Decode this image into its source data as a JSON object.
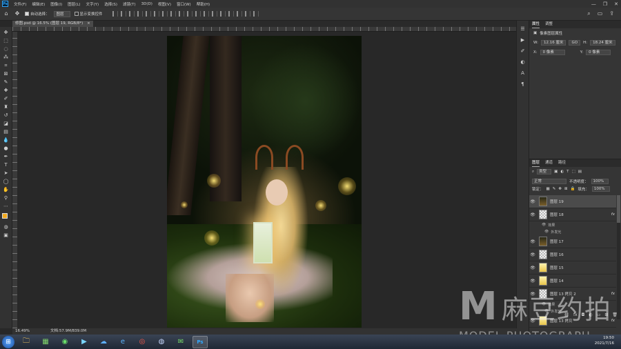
{
  "menubar": {
    "logo": "Ps",
    "items": [
      "文件(F)",
      "编辑(E)",
      "图像(I)",
      "图层(L)",
      "文字(Y)",
      "选择(S)",
      "滤镜(T)",
      "3D(D)",
      "视图(V)",
      "窗口(W)",
      "帮助(H)"
    ],
    "controls": [
      "—",
      "❐",
      "✕"
    ]
  },
  "options": {
    "auto_select_label": "自动选择：",
    "auto_select_value": "图层",
    "show_transform_label": "显示变换控件"
  },
  "document": {
    "tab_title": "修图.psd @ 16.5% (图层 19, RGB/8*)",
    "close": "×"
  },
  "status": {
    "zoom": "16.49%",
    "doc_size": "文档:57.9M/839.0M"
  },
  "properties": {
    "tabs": [
      "属性",
      "调整"
    ],
    "layer_type": "像素图层属性",
    "w_label": "W:",
    "w_value": "12.16 厘米",
    "link": "GO",
    "h_label": "H:",
    "h_value": "18.24 厘米",
    "x_label": "X:",
    "x_value": "0 像素",
    "y_label": "Y:",
    "y_value": "0 像素"
  },
  "layers_panel": {
    "tabs": [
      "图层",
      "通道",
      "路径"
    ],
    "filter_kind": "类型",
    "blend_mode": "正常",
    "opacity_label": "不透明度：",
    "opacity_value": "100%",
    "lock_label": "锁定：",
    "fill_label": "填充：",
    "fill_value": "100%",
    "layers": [
      {
        "name": "图层 19",
        "thumb": "photo",
        "selected": true,
        "fx": ""
      },
      {
        "name": "图层 18",
        "thumb": "checker",
        "selected": false,
        "fx": "fx"
      },
      {
        "name": "图层 17",
        "thumb": "photo",
        "selected": false,
        "fx": ""
      },
      {
        "name": "图层 16",
        "thumb": "checker",
        "selected": false,
        "fx": ""
      },
      {
        "name": "图层 15",
        "thumb": "yellow",
        "selected": false,
        "fx": ""
      },
      {
        "name": "图层 14",
        "thumb": "yellow",
        "selected": false,
        "fx": ""
      },
      {
        "name": "图层 13 拷贝 2",
        "thumb": "checker",
        "selected": false,
        "fx": "fx"
      },
      {
        "name": "图层 13 拷贝",
        "thumb": "yellow",
        "selected": false,
        "fx": "fx"
      }
    ],
    "effects_label": "效果",
    "outer_glow_label": "外发光"
  },
  "watermark": {
    "logo": "M",
    "cn": "麻豆约拍",
    "en": "MODEL PHOTOGRAPH"
  },
  "taskbar": {
    "time": "19:50",
    "date": "2021/7/16"
  },
  "colors": {
    "foreground": "#f0a81e",
    "background": "#ffffff",
    "ui_dark": "#282828"
  }
}
